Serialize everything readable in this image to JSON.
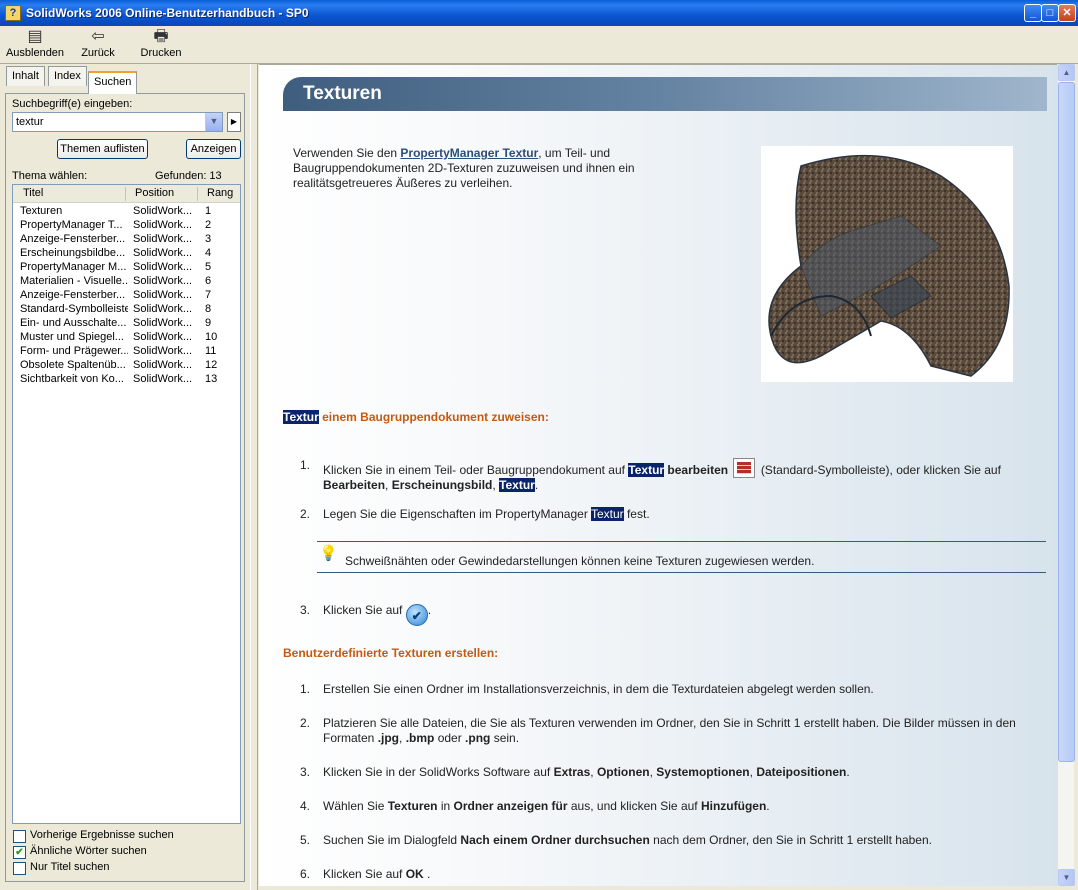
{
  "window": {
    "title": "SolidWorks 2006 Online-Benutzerhandbuch - SP0",
    "buttons": [
      "_",
      "□",
      "✕"
    ]
  },
  "toolbar": {
    "hide": "Ausblenden",
    "back": "Zurück",
    "print": "Drucken"
  },
  "tabs": [
    "Inhalt",
    "Index",
    "Suchen"
  ],
  "search": {
    "label": "Suchbegriff(e) eingeben:",
    "value": "textur",
    "list_button": "Themen auflisten",
    "show_button": "Anzeigen",
    "topic_label": "Thema wählen:",
    "found_label": "Gefunden: 13",
    "columns": [
      "Titel",
      "Position",
      "Rang"
    ],
    "rows": [
      [
        "Texturen",
        "SolidWork...",
        "1"
      ],
      [
        "PropertyManager T...",
        "SolidWork...",
        "2"
      ],
      [
        "Anzeige-Fensterber...",
        "SolidWork...",
        "3"
      ],
      [
        "Erscheinungsbildbe...",
        "SolidWork...",
        "4"
      ],
      [
        "PropertyManager M...",
        "SolidWork...",
        "5"
      ],
      [
        "Materialien - Visuelle...",
        "SolidWork...",
        "6"
      ],
      [
        "Anzeige-Fensterber...",
        "SolidWork...",
        "7"
      ],
      [
        "Standard-Symbolleiste",
        "SolidWork...",
        "8"
      ],
      [
        "Ein- und Ausschalte...",
        "SolidWork...",
        "9"
      ],
      [
        "Muster und Spiegel...",
        "SolidWork...",
        "10"
      ],
      [
        "Form- und Prägewer...",
        "SolidWork...",
        "11"
      ],
      [
        "Obsolete Spaltenüb...",
        "SolidWork...",
        "12"
      ],
      [
        "Sichtbarkeit von Ko...",
        "SolidWork...",
        "13"
      ]
    ],
    "options": [
      {
        "label": "Vorherige Ergebnisse suchen",
        "checked": false
      },
      {
        "label": "Ähnliche Wörter suchen",
        "checked": true
      },
      {
        "label": "Nur Titel suchen",
        "checked": false
      }
    ]
  },
  "content": {
    "title": "Texturen",
    "intro_1": "Verwenden Sie den ",
    "intro_link": "PropertyManager Textur",
    "intro_2": ", um Teil- und",
    "intro_line2": "Baugruppendokumenten 2D-Texturen zuzuweisen und ihnen ein",
    "intro_line3": "realitätsgetreueres Äußeres zu verleihen.",
    "section1_kw": "Textur",
    "section1_rest": " einem Baugruppendokument zuweisen:",
    "step1_num": "1.",
    "step1_a": "Klicken Sie in einem Teil- oder Baugruppendokument auf ",
    "step1_kw1": "Textur",
    "step1_b": " bearbeiten",
    "step1_c": " (Standard-Symbolleiste), oder klicken Sie auf",
    "step1_d": "Bearbeiten",
    "step1_e": ", ",
    "step1_f": "Erscheinungsbild",
    "step1_g": ", ",
    "step1_kw2": "Textur",
    "step1_h": ".",
    "step2_num": "2.",
    "step2_a": "Legen Sie die Eigenschaften im PropertyManager ",
    "step2_kw": "Textur",
    "step2_b": " fest.",
    "tip": "Schweißnähten oder Gewindedarstellungen können keine Texturen zugewiesen werden.",
    "step3_num": "3.",
    "step3": "Klicken Sie auf",
    "step3_end": ".",
    "section2": "Benutzerdefinierte Texturen erstellen:",
    "b_steps": [
      {
        "num": "1.",
        "text": "Erstellen Sie einen Ordner im Installationsverzeichnis, in dem die Texturdateien abgelegt werden sollen."
      },
      {
        "num": "2.",
        "line1": "Platzieren Sie alle Dateien, die Sie als Texturen verwenden im Ordner, den Sie in Schritt 1 erstellt haben. Die Bilder müssen in den",
        "line2_a": "Formaten ",
        "jpg": ".jpg",
        "sep1": ", ",
        "bmp": ".bmp",
        "sep2": " oder ",
        "png": ".png",
        "line2_b": " sein."
      },
      {
        "num": "3.",
        "a": "Klicken Sie in der SolidWorks Software auf ",
        "b1": "Extras",
        "s1": ", ",
        "b2": "Optionen",
        "s2": ", ",
        "b3": "Systemoptionen",
        "s3": ", ",
        "b4": "Dateipositionen",
        "end": "."
      },
      {
        "num": "4.",
        "a": "Wählen Sie ",
        "b1": "Texturen",
        "m1": " in ",
        "b2": "Ordner anzeigen für",
        "m2": " aus, und klicken Sie auf ",
        "b3": "Hinzufügen",
        "end": "."
      },
      {
        "num": "5.",
        "a": "Suchen Sie im Dialogfeld ",
        "b1": "Nach einem Ordner durchsuchen",
        "m1": " nach dem Ordner, den Sie in Schritt 1 erstellt haben."
      },
      {
        "num": "6.",
        "a": "Klicken Sie auf ",
        "b1": "OK",
        "end": " ."
      }
    ]
  }
}
